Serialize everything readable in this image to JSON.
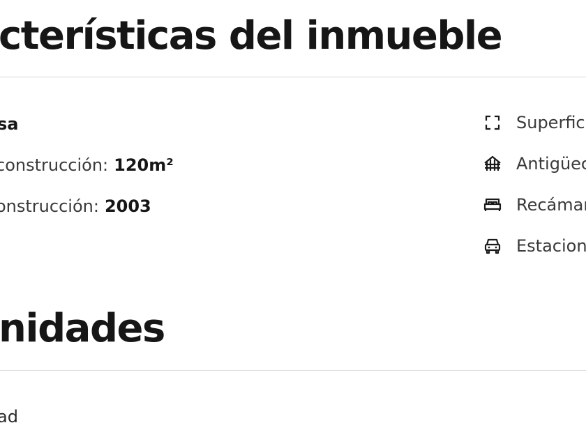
{
  "features": {
    "title": "cterísticas del inmueble",
    "rows": [
      {
        "label": "sa",
        "value": ""
      },
      {
        "label": "construcción:",
        "value": "120m²"
      },
      {
        "label": "onstrucción:",
        "value": "2003"
      }
    ],
    "right_items": [
      {
        "icon": "area-frame-icon",
        "label": "Superfic"
      },
      {
        "icon": "building-age-icon",
        "label": "Antigüec"
      },
      {
        "icon": "bed-icon",
        "label": "Recámar"
      },
      {
        "icon": "car-icon",
        "label": "Estacion"
      }
    ]
  },
  "amenities": {
    "title": "nidades",
    "first_item": "ad"
  }
}
